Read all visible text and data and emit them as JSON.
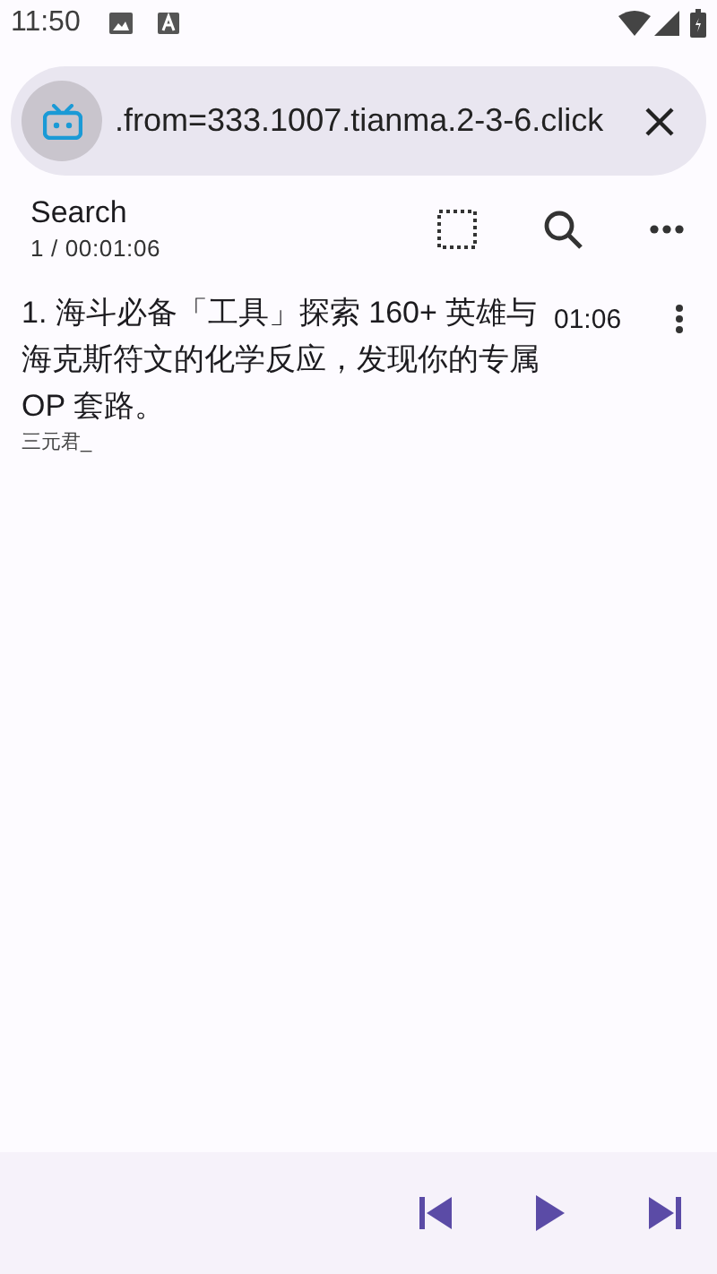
{
  "status_bar": {
    "time": "11:50"
  },
  "address_bar": {
    "url": ".from=333.1007.tianma.2-3-6.click"
  },
  "header": {
    "title": "Search",
    "subtitle": "1 / 00:01:06"
  },
  "items": [
    {
      "title": "1. 海斗必备「工具」探索 160+ 英雄与海克斯符文的化学反应，发现你的专属 OP 套路。",
      "author": "三元君_",
      "duration": "01:06"
    }
  ]
}
